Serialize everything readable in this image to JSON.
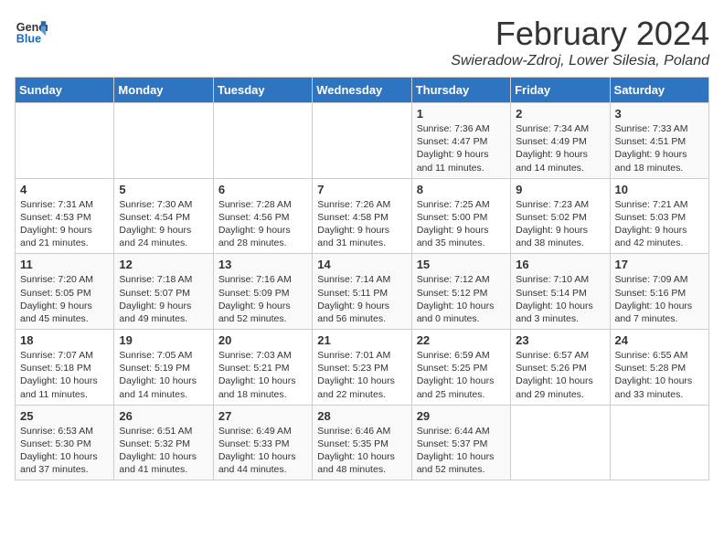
{
  "logo": {
    "line1": "General",
    "line2": "Blue"
  },
  "title": "February 2024",
  "location": "Swieradow-Zdroj, Lower Silesia, Poland",
  "days_of_week": [
    "Sunday",
    "Monday",
    "Tuesday",
    "Wednesday",
    "Thursday",
    "Friday",
    "Saturday"
  ],
  "weeks": [
    [
      {
        "day": "",
        "info": ""
      },
      {
        "day": "",
        "info": ""
      },
      {
        "day": "",
        "info": ""
      },
      {
        "day": "",
        "info": ""
      },
      {
        "day": "1",
        "info": "Sunrise: 7:36 AM\nSunset: 4:47 PM\nDaylight: 9 hours\nand 11 minutes."
      },
      {
        "day": "2",
        "info": "Sunrise: 7:34 AM\nSunset: 4:49 PM\nDaylight: 9 hours\nand 14 minutes."
      },
      {
        "day": "3",
        "info": "Sunrise: 7:33 AM\nSunset: 4:51 PM\nDaylight: 9 hours\nand 18 minutes."
      }
    ],
    [
      {
        "day": "4",
        "info": "Sunrise: 7:31 AM\nSunset: 4:53 PM\nDaylight: 9 hours\nand 21 minutes."
      },
      {
        "day": "5",
        "info": "Sunrise: 7:30 AM\nSunset: 4:54 PM\nDaylight: 9 hours\nand 24 minutes."
      },
      {
        "day": "6",
        "info": "Sunrise: 7:28 AM\nSunset: 4:56 PM\nDaylight: 9 hours\nand 28 minutes."
      },
      {
        "day": "7",
        "info": "Sunrise: 7:26 AM\nSunset: 4:58 PM\nDaylight: 9 hours\nand 31 minutes."
      },
      {
        "day": "8",
        "info": "Sunrise: 7:25 AM\nSunset: 5:00 PM\nDaylight: 9 hours\nand 35 minutes."
      },
      {
        "day": "9",
        "info": "Sunrise: 7:23 AM\nSunset: 5:02 PM\nDaylight: 9 hours\nand 38 minutes."
      },
      {
        "day": "10",
        "info": "Sunrise: 7:21 AM\nSunset: 5:03 PM\nDaylight: 9 hours\nand 42 minutes."
      }
    ],
    [
      {
        "day": "11",
        "info": "Sunrise: 7:20 AM\nSunset: 5:05 PM\nDaylight: 9 hours\nand 45 minutes."
      },
      {
        "day": "12",
        "info": "Sunrise: 7:18 AM\nSunset: 5:07 PM\nDaylight: 9 hours\nand 49 minutes."
      },
      {
        "day": "13",
        "info": "Sunrise: 7:16 AM\nSunset: 5:09 PM\nDaylight: 9 hours\nand 52 minutes."
      },
      {
        "day": "14",
        "info": "Sunrise: 7:14 AM\nSunset: 5:11 PM\nDaylight: 9 hours\nand 56 minutes."
      },
      {
        "day": "15",
        "info": "Sunrise: 7:12 AM\nSunset: 5:12 PM\nDaylight: 10 hours\nand 0 minutes."
      },
      {
        "day": "16",
        "info": "Sunrise: 7:10 AM\nSunset: 5:14 PM\nDaylight: 10 hours\nand 3 minutes."
      },
      {
        "day": "17",
        "info": "Sunrise: 7:09 AM\nSunset: 5:16 PM\nDaylight: 10 hours\nand 7 minutes."
      }
    ],
    [
      {
        "day": "18",
        "info": "Sunrise: 7:07 AM\nSunset: 5:18 PM\nDaylight: 10 hours\nand 11 minutes."
      },
      {
        "day": "19",
        "info": "Sunrise: 7:05 AM\nSunset: 5:19 PM\nDaylight: 10 hours\nand 14 minutes."
      },
      {
        "day": "20",
        "info": "Sunrise: 7:03 AM\nSunset: 5:21 PM\nDaylight: 10 hours\nand 18 minutes."
      },
      {
        "day": "21",
        "info": "Sunrise: 7:01 AM\nSunset: 5:23 PM\nDaylight: 10 hours\nand 22 minutes."
      },
      {
        "day": "22",
        "info": "Sunrise: 6:59 AM\nSunset: 5:25 PM\nDaylight: 10 hours\nand 25 minutes."
      },
      {
        "day": "23",
        "info": "Sunrise: 6:57 AM\nSunset: 5:26 PM\nDaylight: 10 hours\nand 29 minutes."
      },
      {
        "day": "24",
        "info": "Sunrise: 6:55 AM\nSunset: 5:28 PM\nDaylight: 10 hours\nand 33 minutes."
      }
    ],
    [
      {
        "day": "25",
        "info": "Sunrise: 6:53 AM\nSunset: 5:30 PM\nDaylight: 10 hours\nand 37 minutes."
      },
      {
        "day": "26",
        "info": "Sunrise: 6:51 AM\nSunset: 5:32 PM\nDaylight: 10 hours\nand 41 minutes."
      },
      {
        "day": "27",
        "info": "Sunrise: 6:49 AM\nSunset: 5:33 PM\nDaylight: 10 hours\nand 44 minutes."
      },
      {
        "day": "28",
        "info": "Sunrise: 6:46 AM\nSunset: 5:35 PM\nDaylight: 10 hours\nand 48 minutes."
      },
      {
        "day": "29",
        "info": "Sunrise: 6:44 AM\nSunset: 5:37 PM\nDaylight: 10 hours\nand 52 minutes."
      },
      {
        "day": "",
        "info": ""
      },
      {
        "day": "",
        "info": ""
      }
    ]
  ]
}
